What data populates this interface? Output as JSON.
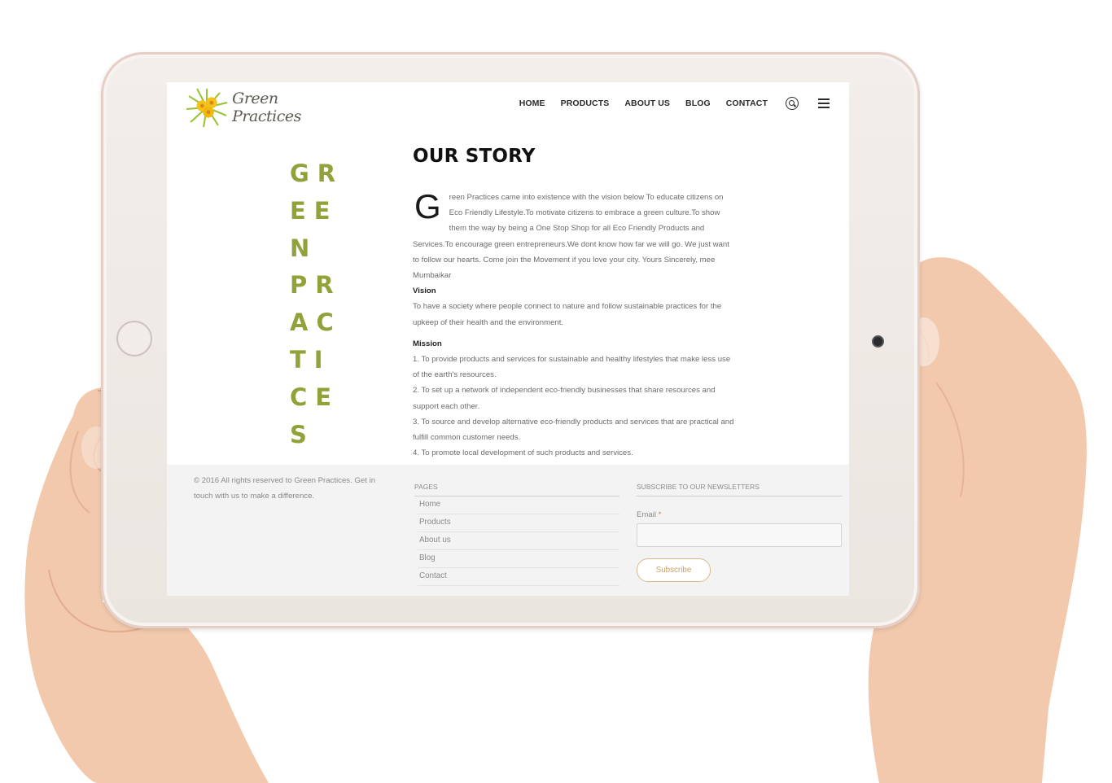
{
  "logo": {
    "text": "Green Practices"
  },
  "nav": {
    "items": [
      "HOME",
      "PRODUCTS",
      "ABOUT US",
      "BLOG",
      "CONTACT"
    ]
  },
  "wordmark": {
    "lines": [
      "GR",
      "EE",
      "N",
      "PR",
      "AC",
      "TI",
      "CE",
      "S"
    ],
    "color": "#8fa33a"
  },
  "story": {
    "title": "OUR STORY",
    "dropcap": "G",
    "intro": "reen Practices came into existence with the vision below To educate citizens on Eco Friendly Lifestyle.To motivate citizens to embrace a green culture.To show them the way by being a One Stop Shop for all Eco Friendly Products and Services.To encourage green entrepreneurs.We dont know how far we will go. We just want to follow our hearts. Come join the Movement if you love your city. Yours Sincerely, mee Mumbaikar",
    "vision_label": "Vision",
    "vision_text": "To have a society where people connect to nature and follow sustainable practices for the upkeep of their health and the environment.",
    "mission_label": "Mission",
    "mission_items": [
      "1. To provide products and services for sustainable and healthy lifestyles that make less use of the earth's resources.",
      "2. To set up a network of independent eco-friendly businesses that share resources and support each other.",
      "3. To source and develop alternative eco-friendly products and services that are practical and fulfill common customer needs.",
      "4. To promote local development of such products and services."
    ]
  },
  "footer": {
    "copyright": "© 2016 All rights reserved to Green Practices. Get in touch with us to make a difference.",
    "pages_title": "PAGES",
    "pages": [
      "Home",
      "Products",
      "About us",
      "Blog",
      "Contact"
    ],
    "newsletter_title": "SUBSCRIBE TO OUR NEWSLETTERS",
    "email_label": "Email",
    "email_required": "*",
    "subscribe_label": "Subscribe"
  }
}
